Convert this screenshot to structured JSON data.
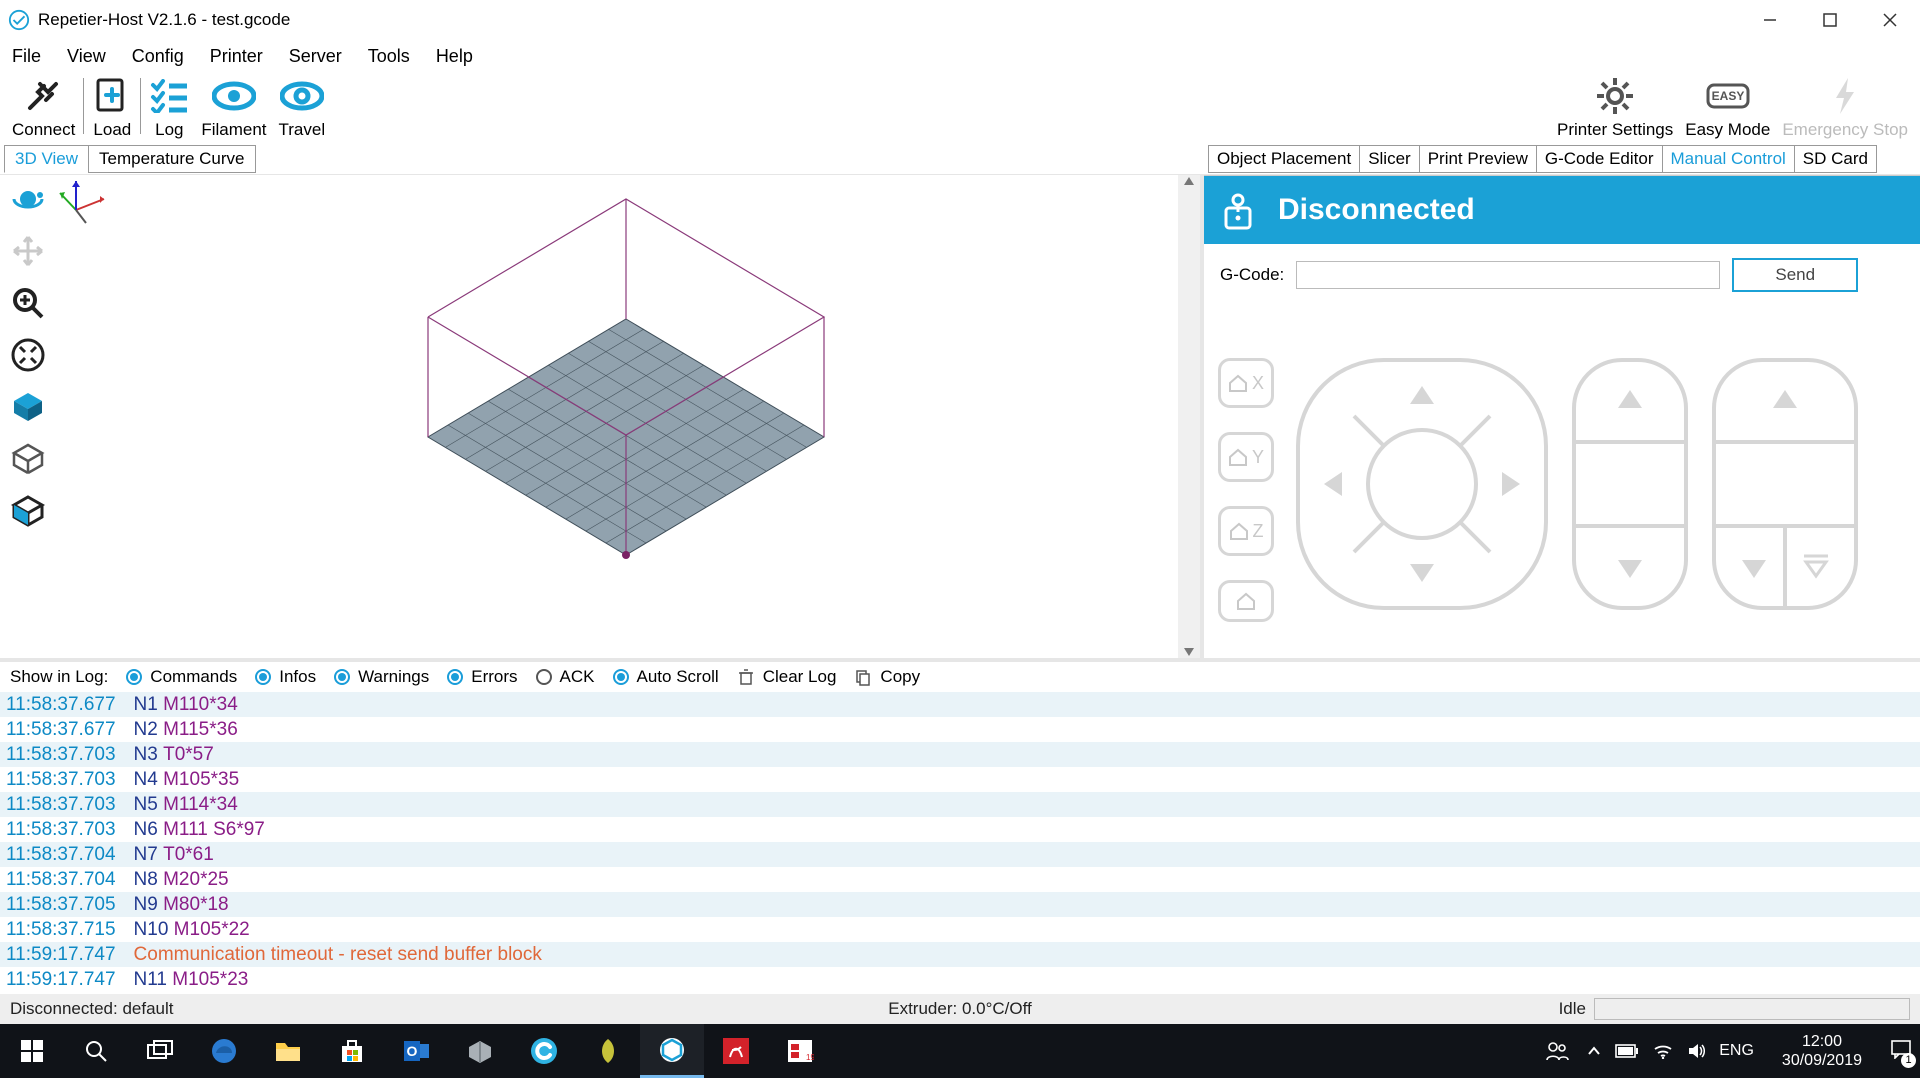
{
  "window": {
    "title": "Repetier-Host V2.1.6 - test.gcode"
  },
  "menu": [
    "File",
    "View",
    "Config",
    "Printer",
    "Server",
    "Tools",
    "Help"
  ],
  "toolbar": {
    "connect": "Connect",
    "load": "Load",
    "log": "Log",
    "filament": "Filament",
    "travel": "Travel",
    "printer_settings": "Printer Settings",
    "easy_mode": "Easy Mode",
    "emergency": "Emergency Stop"
  },
  "viewtabs": {
    "v3d": "3D View",
    "temp": "Temperature Curve"
  },
  "righttabs": {
    "obj": "Object Placement",
    "slicer": "Slicer",
    "preview": "Print Preview",
    "gedit": "G-Code Editor",
    "manual": "Manual Control",
    "sd": "SD Card"
  },
  "manual": {
    "banner": "Disconnected",
    "gcode_label": "G-Code:",
    "gcode_value": "",
    "send": "Send",
    "home_x": "X",
    "home_y": "Y",
    "home_z": "Z"
  },
  "logbar": {
    "show": "Show in Log:",
    "commands": "Commands",
    "infos": "Infos",
    "warnings": "Warnings",
    "errors": "Errors",
    "ack": "ACK",
    "autoscroll": "Auto Scroll",
    "clear": "Clear Log",
    "copy": "Copy"
  },
  "log": [
    {
      "ts": "11:58:37.677",
      "n": "N1",
      "c": "M110*34"
    },
    {
      "ts": "11:58:37.677",
      "n": "N2",
      "c": "M115*36"
    },
    {
      "ts": "11:58:37.703",
      "n": "N3",
      "c": "T0*57"
    },
    {
      "ts": "11:58:37.703",
      "n": "N4",
      "c": "M105*35"
    },
    {
      "ts": "11:58:37.703",
      "n": "N5",
      "c": "M114*34"
    },
    {
      "ts": "11:58:37.703",
      "n": "N6",
      "c": "M111 S6*97"
    },
    {
      "ts": "11:58:37.704",
      "n": "N7",
      "c": "T0*61"
    },
    {
      "ts": "11:58:37.704",
      "n": "N8",
      "c": "M20*25"
    },
    {
      "ts": "11:58:37.705",
      "n": "N9",
      "c": "M80*18"
    },
    {
      "ts": "11:58:37.715",
      "n": "N10",
      "c": "M105*22"
    },
    {
      "ts": "11:59:17.747",
      "err": "Communication timeout - reset send buffer block"
    },
    {
      "ts": "11:59:17.747",
      "n": "N11",
      "c": "M105*23"
    }
  ],
  "status": {
    "left": "Disconnected: default",
    "extruder": "Extruder: 0.0°C/Off",
    "idle": "Idle"
  },
  "taskbar": {
    "lang": "ENG",
    "time": "12:00",
    "date": "30/09/2019"
  }
}
